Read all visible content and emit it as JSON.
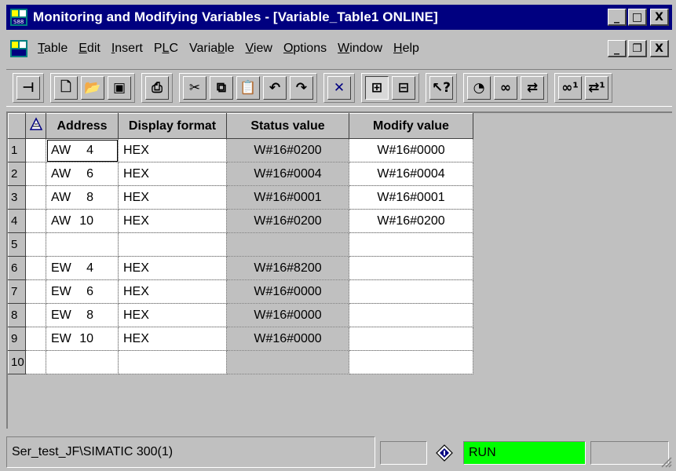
{
  "window": {
    "title": "Monitoring and Modifying Variables - [Variable_Table1  ONLINE]",
    "app_icon": "simatic-app-icon",
    "caption_buttons": {
      "minimize": "_",
      "maximize": "□",
      "close": "X"
    }
  },
  "menubar": {
    "doc_icon": "simatic-doc-icon",
    "items": [
      {
        "label": "Table",
        "accel": "T",
        "rest": "able"
      },
      {
        "label": "Edit",
        "accel": "E",
        "rest": "dit"
      },
      {
        "label": "Insert",
        "accel": "I",
        "rest": "nsert"
      },
      {
        "label": "PLC",
        "pre": "P",
        "accel": "L",
        "rest": "C"
      },
      {
        "label": "Variable",
        "pre": "Varia",
        "accel": "b",
        "rest": "le"
      },
      {
        "label": "View",
        "accel": "V",
        "rest": "iew"
      },
      {
        "label": "Options",
        "accel": "O",
        "rest": "ptions"
      },
      {
        "label": "Window",
        "accel": "W",
        "rest": "indow"
      },
      {
        "label": "Help",
        "accel": "H",
        "rest": "elp"
      }
    ],
    "doc_buttons": {
      "minimize": "_",
      "restore": "❐",
      "close": "X"
    }
  },
  "toolbar": {
    "groups": [
      [
        {
          "name": "pin-icon",
          "glyph": "⊣"
        }
      ],
      [
        {
          "name": "new-icon",
          "glyph": "🗋"
        },
        {
          "name": "open-icon",
          "glyph": "📂"
        },
        {
          "name": "save-icon",
          "glyph": "▣"
        }
      ],
      [
        {
          "name": "print-icon",
          "glyph": "⎙"
        }
      ],
      [
        {
          "name": "cut-icon",
          "glyph": "✂"
        },
        {
          "name": "copy-icon",
          "glyph": "⧉"
        },
        {
          "name": "paste-icon",
          "glyph": "📋",
          "disabled": true
        },
        {
          "name": "undo-icon",
          "glyph": "↶"
        },
        {
          "name": "redo-icon",
          "glyph": "↷"
        }
      ],
      [
        {
          "name": "delete-icon",
          "glyph": "✕",
          "color": "#000080"
        }
      ],
      [
        {
          "name": "online-icon",
          "glyph": "⊞",
          "pressed": true
        },
        {
          "name": "offline-icon",
          "glyph": "⊟"
        }
      ],
      [
        {
          "name": "help-pointer-icon",
          "glyph": "↖?"
        }
      ],
      [
        {
          "name": "trigger-icon",
          "glyph": "◔"
        },
        {
          "name": "monitor-icon",
          "glyph": "∞"
        },
        {
          "name": "modify-icon",
          "glyph": "⇄"
        }
      ],
      [
        {
          "name": "monitor-once-icon",
          "glyph": "∞¹"
        },
        {
          "name": "modify-once-icon",
          "glyph": "⇄¹"
        }
      ]
    ]
  },
  "table": {
    "headers": {
      "marker": "",
      "address": "Address",
      "display_format": "Display format",
      "status_value": "Status value",
      "modify_value": "Modify value"
    },
    "rows": [
      {
        "num": "1",
        "op": "AW",
        "addr": "4",
        "format": "HEX",
        "status": "W#16#0200",
        "modify": "W#16#0000"
      },
      {
        "num": "2",
        "op": "AW",
        "addr": "6",
        "format": "HEX",
        "status": "W#16#0004",
        "modify": "W#16#0004"
      },
      {
        "num": "3",
        "op": "AW",
        "addr": "8",
        "format": "HEX",
        "status": "W#16#0001",
        "modify": "W#16#0001"
      },
      {
        "num": "4",
        "op": "AW",
        "addr": "10",
        "format": "HEX",
        "status": "W#16#0200",
        "modify": "W#16#0200"
      },
      {
        "num": "5",
        "op": "",
        "addr": "",
        "format": "",
        "status": "",
        "modify": ""
      },
      {
        "num": "6",
        "op": "EW",
        "addr": "4",
        "format": "HEX",
        "status": "W#16#8200",
        "modify": ""
      },
      {
        "num": "7",
        "op": "EW",
        "addr": "6",
        "format": "HEX",
        "status": "W#16#0000",
        "modify": ""
      },
      {
        "num": "8",
        "op": "EW",
        "addr": "8",
        "format": "HEX",
        "status": "W#16#0000",
        "modify": ""
      },
      {
        "num": "9",
        "op": "EW",
        "addr": "10",
        "format": "HEX",
        "status": "W#16#0000",
        "modify": ""
      },
      {
        "num": "10",
        "op": "",
        "addr": "",
        "format": "",
        "status": "",
        "modify": ""
      }
    ]
  },
  "statusbar": {
    "path": "Ser_test_JF\\SIMATIC 300(1)",
    "mode": "RUN",
    "mode_color": "#00ff00",
    "indicator_icon": "diamond-indicator-icon"
  },
  "colors": {
    "titlebar": "#000080",
    "face": "#c0c0c0",
    "cell": "#ffffff"
  }
}
